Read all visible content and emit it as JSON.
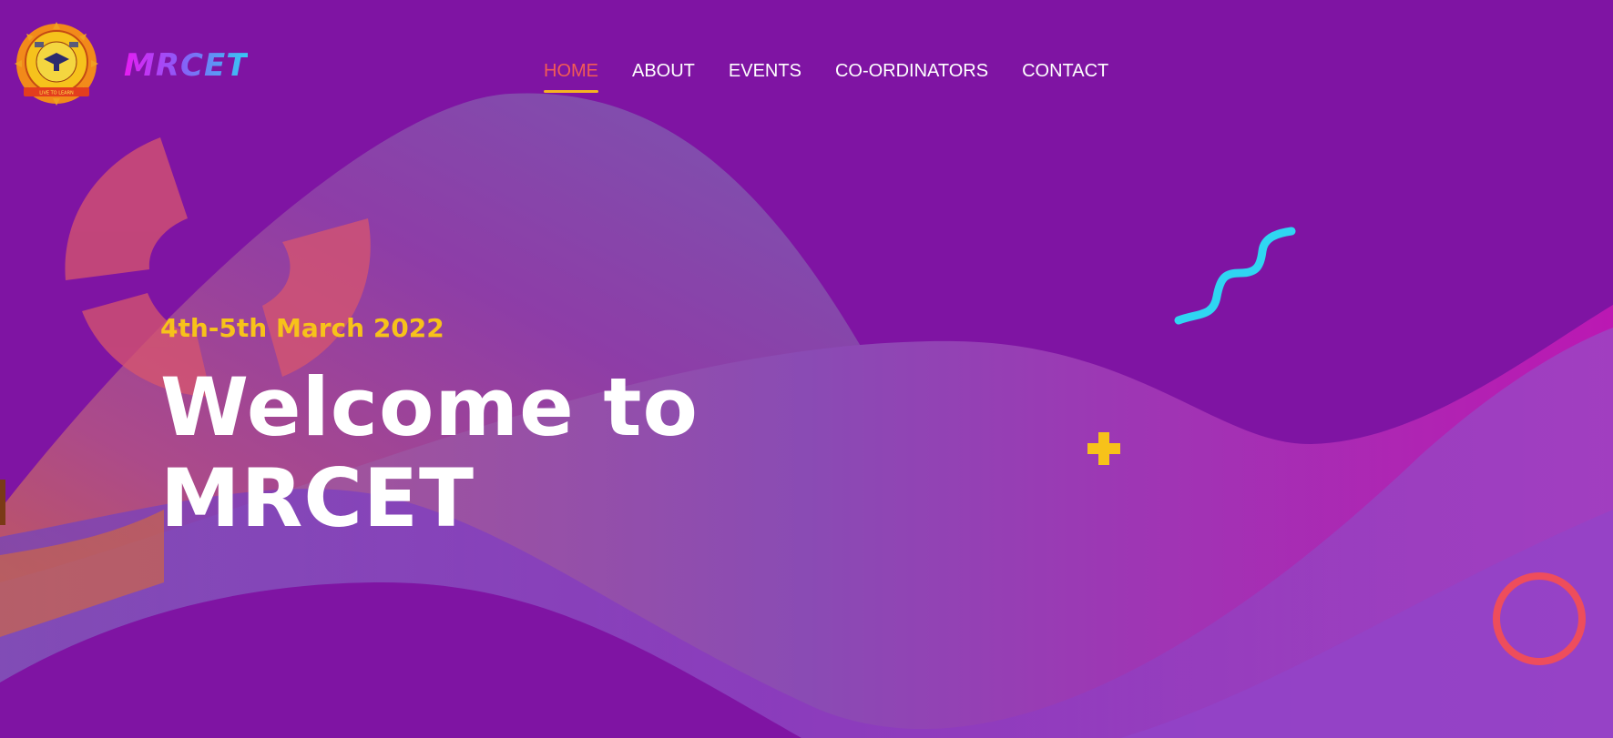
{
  "brand": {
    "name": "MRCET",
    "emblem_icon": "college-emblem-icon"
  },
  "nav": {
    "items": [
      {
        "label": "HOME",
        "active": true
      },
      {
        "label": "ABOUT",
        "active": false
      },
      {
        "label": "EVENTS",
        "active": false
      },
      {
        "label": "CO-ORDINATORS",
        "active": false
      },
      {
        "label": "CONTACT",
        "active": false
      }
    ]
  },
  "hero": {
    "date": "4th-5th March 2022",
    "title_line1": "Welcome to",
    "title_line2": "MRCET"
  },
  "decorations": {
    "squiggle_icon": "squiggle-icon",
    "plus_icon": "plus-icon",
    "ring_icon": "ring-icon",
    "arc_icon": "broken-ring-icon"
  },
  "colors": {
    "background": "#7f14a3",
    "nav_active": "#f25b55",
    "nav_underline": "#f6b321",
    "date": "#f7c21a",
    "title": "#ffffff",
    "squiggle": "#2fd6f2",
    "plus": "#f7c21a",
    "ring": "#ee4d5c"
  }
}
